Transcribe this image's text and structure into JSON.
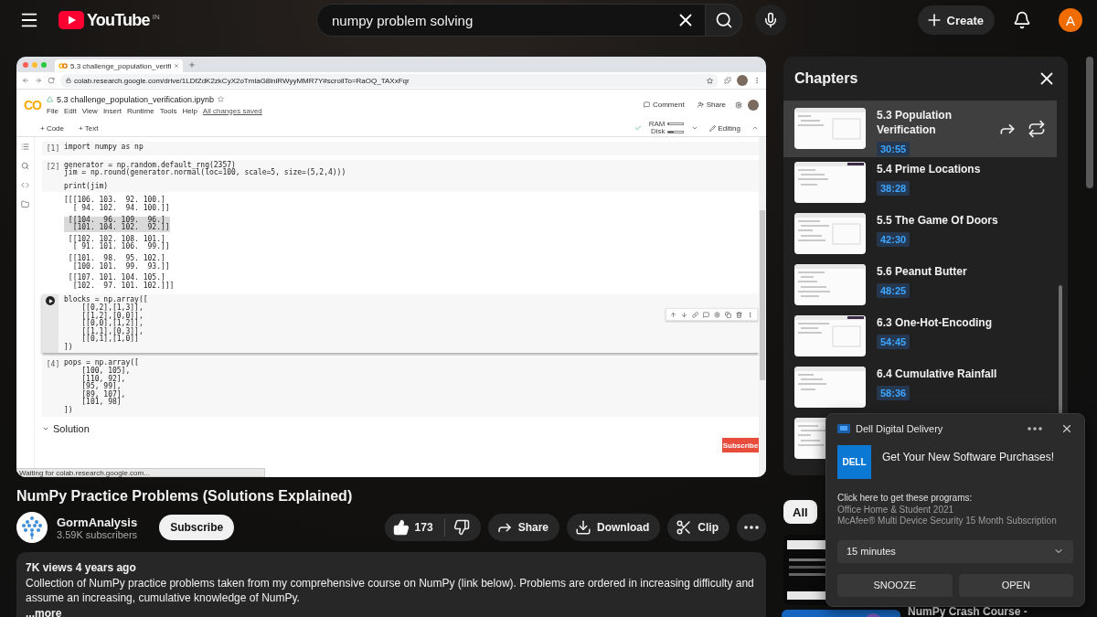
{
  "topbar": {
    "logo": "YouTube",
    "region": "IN",
    "search": {
      "value": "numpy problem solving"
    },
    "create": "Create",
    "avatar": "A"
  },
  "video": {
    "browser": {
      "tab_title": "5.3 challenge_population_verifi",
      "url": "colab.research.google.com/drive/1LDfZdK2zkCyX2oTmlaG8lniRWyyMMR7Y#scrollTo=RaOQ_TAXxFqr"
    },
    "colab": {
      "logo": "CO",
      "title": "5.3 challenge_population_verification.ipynb",
      "menu": [
        "File",
        "Edit",
        "View",
        "Insert",
        "Runtime",
        "Tools",
        "Help"
      ],
      "saved": "All changes saved",
      "comment": "Comment",
      "share": "Share",
      "add": [
        "+ Code",
        "+ Text"
      ],
      "ram": {
        "label": "RAM",
        "level": 0.08
      },
      "disk": {
        "label": "Disk",
        "level": 0.4
      },
      "editing": "Editing",
      "cells": [
        {
          "kind": "code",
          "prompt": "[1]",
          "selected": false,
          "paragraphs": [
            [
              "import numpy as np"
            ]
          ]
        },
        {
          "kind": "code",
          "prompt": "[2]",
          "selected": false,
          "paragraphs": [
            [
              "generator = np.random.default_rng(2357)",
              "jim = np.round(generator.normal(loc=100, scale=5, size=(5,2,4)))"
            ],
            [
              "print(jim)"
            ]
          ]
        },
        {
          "kind": "output",
          "groups": [
            {
              "selected": false,
              "lines": [
                "[[[106. 103.  92. 100.]",
                "  [ 94. 102.  94. 100.]]"
              ]
            },
            {
              "selected": true,
              "lines": [
                " [[104.  96. 109.  96.]",
                "  [101. 104. 102.  92.]]"
              ]
            },
            {
              "selected": false,
              "lines": [
                " [[102. 102. 108. 101.]",
                "  [ 91. 101. 106.  99.]]"
              ]
            },
            {
              "selected": false,
              "lines": [
                " [[101.  98.  95. 102.]",
                "  [100. 101.  99.  93.]]"
              ]
            },
            {
              "selected": false,
              "lines": [
                " [[107. 101. 104. 105.]",
                "  [102.  97. 101. 102.]]]"
              ]
            }
          ]
        },
        {
          "kind": "code",
          "selected": true,
          "paragraphs": [
            [
              "blocks = np.array([",
              "    [[0,2],[1,3]],",
              "    [[1,2],[0,0]],",
              "    [[0,0],[1,2]],",
              "    [[1,1],[0,3]],",
              "    [[0,1],[1,0]]",
              "])"
            ]
          ]
        },
        {
          "kind": "code",
          "prompt": "[4]",
          "selected": false,
          "paragraphs": [
            [
              "pops = np.array([",
              "    [100, 105],",
              "    [110, 92],",
              "    [95, 99],",
              "    [89, 107],",
              "    [101, 98]",
              "])"
            ]
          ]
        }
      ],
      "section": "Solution",
      "status": "Waiting for colab.research.google.com...",
      "badge": "Subscribe"
    }
  },
  "title": "NumPy Practice Problems (Solutions Explained)",
  "channel": {
    "name": "GormAnalysis",
    "subscribers": "3.59K subscribers",
    "subscribe": "Subscribe"
  },
  "actions": {
    "likes": "173",
    "share": "Share",
    "download": "Download",
    "clip": "Clip"
  },
  "description": {
    "meta": "7K views  4 years ago",
    "text": "Collection of NumPy practice problems taken from my comprehensive course on NumPy (link below). Problems are ordered in increasing difficulty and assume an increasing, cumulative knowledge of NumPy.",
    "more": "...more"
  },
  "chapters": {
    "title": "Chapters",
    "items": [
      {
        "title": "5.3 Population Verification",
        "time": "30:55",
        "selected": true
      },
      {
        "title": "5.4 Prime Locations",
        "time": "38:28",
        "selected": false
      },
      {
        "title": "5.5 The Game Of Doors",
        "time": "42:30",
        "selected": false
      },
      {
        "title": "5.6 Peanut Butter",
        "time": "48:25",
        "selected": false
      },
      {
        "title": "6.3 One-Hot-Encoding",
        "time": "54:45",
        "selected": false
      },
      {
        "title": "6.4 Cumulative Rainfall",
        "time": "58:36",
        "selected": false
      }
    ]
  },
  "chips": [
    {
      "label": "All",
      "selected": true
    }
  ],
  "related": [
    {
      "title": "NumPy Crash Course -"
    }
  ],
  "notification": {
    "app": "Dell Digital Delivery",
    "logo": "DELL",
    "heading": "Get Your New Software Purchases!",
    "intro": "Click here to get these programs:",
    "programs": [
      "Office Home & Student 2021",
      "McAfee® Multi Device Security 15 Month Subscription"
    ],
    "snooze_time": "15 minutes",
    "buttons": [
      "SNOOZE",
      "OPEN"
    ]
  }
}
